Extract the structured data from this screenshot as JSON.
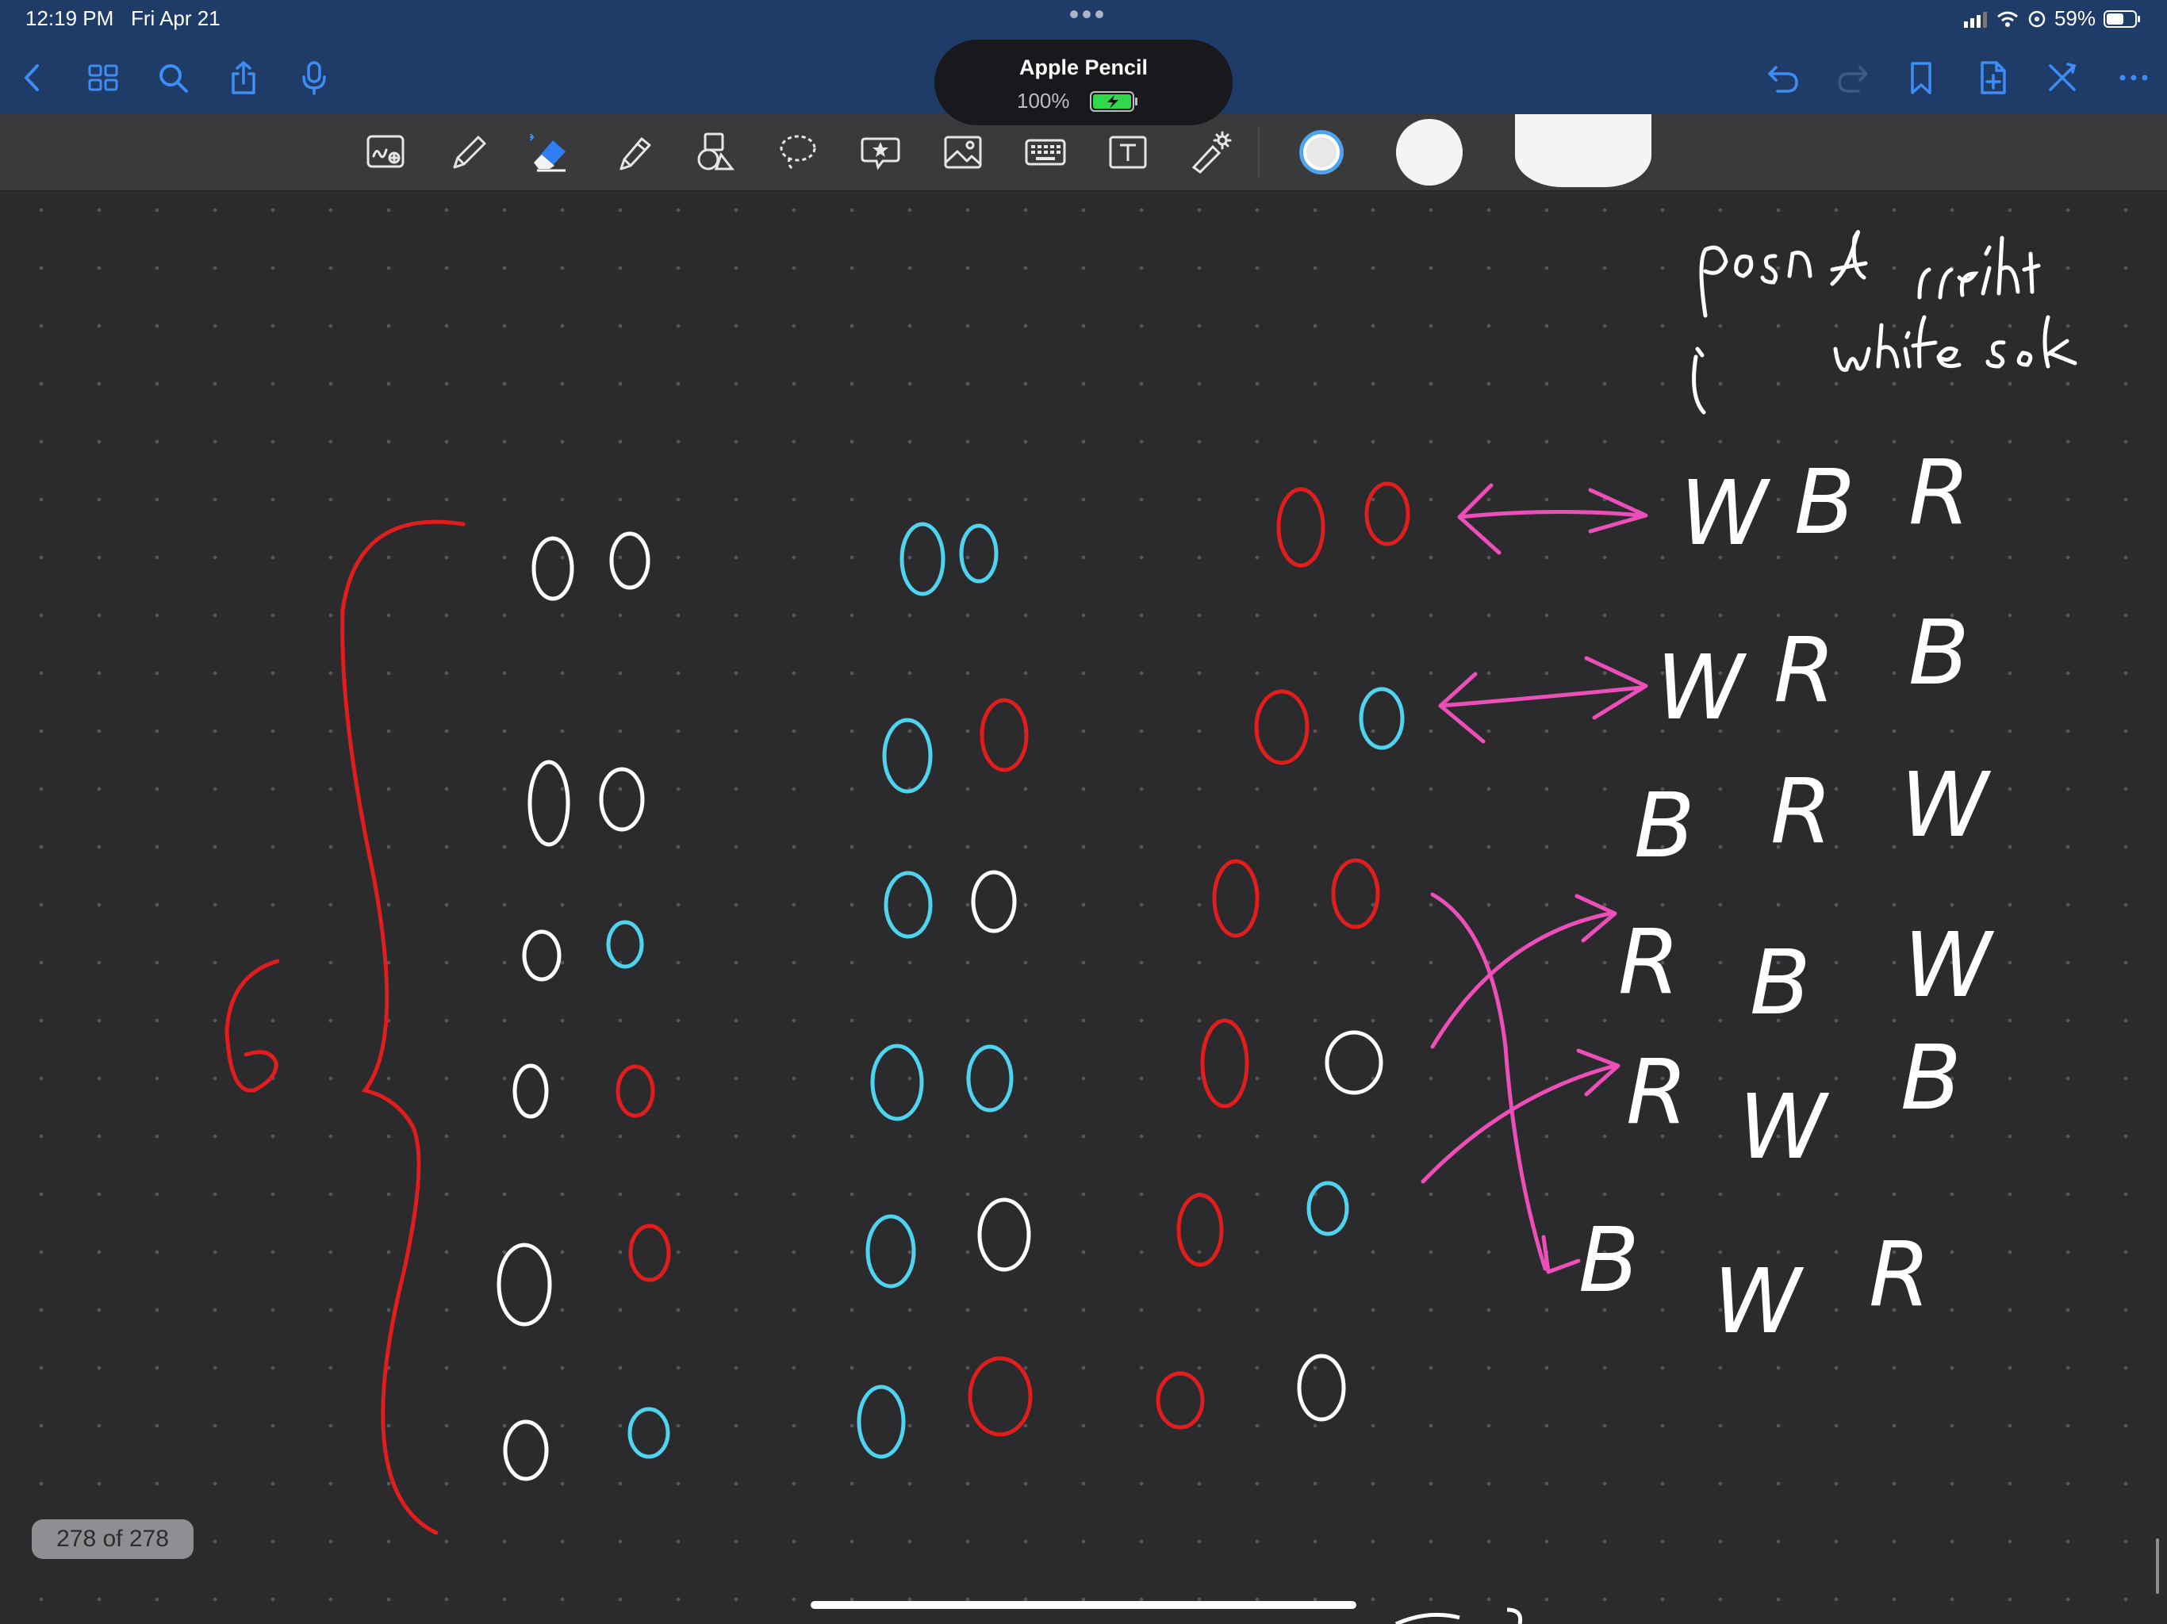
{
  "status_bar": {
    "time": "12:19 PM",
    "date": "Fri Apr 21",
    "battery": "59%"
  },
  "pencil_popup": {
    "name": "Apple Pencil",
    "battery": "100%"
  },
  "page_counter": "278 of 278",
  "colors": {
    "nav_background": "#1f3c68",
    "nav_icon": "#3d8df5",
    "toolbar_background": "#3a3a3c",
    "canvas_background": "#2b2b2d",
    "ink_white": "#ffffff",
    "ink_red": "#e11d1d",
    "ink_cyan": "#4fd3ee",
    "ink_pink": "#ec4fb8"
  },
  "nav_icons": [
    "back-icon",
    "grid-icon",
    "search-icon",
    "share-icon",
    "microphone-icon",
    "undo-icon",
    "redo-icon",
    "bookmark-icon",
    "add-page-icon",
    "close-icon",
    "more-icon"
  ],
  "tool_icons": [
    "zoom-window-icon",
    "pen-icon",
    "eraser-icon",
    "highlighter-icon",
    "shapes-icon",
    "lasso-icon",
    "elements-icon",
    "image-icon",
    "keyboard-icon",
    "text-box-icon",
    "laser-pointer-icon"
  ],
  "handwritten_notes": {
    "header_line1": "posn of rrsht",
    "header_line2": "white sock",
    "brace_count": "6",
    "permutations": [
      [
        "W",
        "B",
        "R"
      ],
      [
        "W",
        "R",
        "B"
      ],
      [
        "B",
        "R",
        "W"
      ],
      [
        "R",
        "B",
        "W"
      ],
      [
        "R",
        "W",
        "B"
      ],
      [
        "B",
        "W",
        "R"
      ]
    ],
    "ink_legend": {
      "W": "white",
      "R": "red",
      "B": "blue"
    }
  }
}
